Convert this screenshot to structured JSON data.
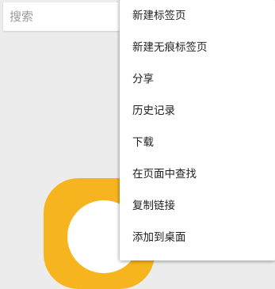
{
  "search": {
    "placeholder": "搜索"
  },
  "menu": {
    "items": [
      {
        "label": "新建标签页"
      },
      {
        "label": "新建无痕标签页"
      },
      {
        "label": "分享"
      },
      {
        "label": "历史记录"
      },
      {
        "label": "下载"
      },
      {
        "label": "在页面中查找"
      },
      {
        "label": "复制链接"
      },
      {
        "label": "添加到桌面"
      }
    ]
  },
  "colors": {
    "logo": "#f6b51e",
    "menu_background": "#ffffff",
    "page_background": "#ececec"
  }
}
